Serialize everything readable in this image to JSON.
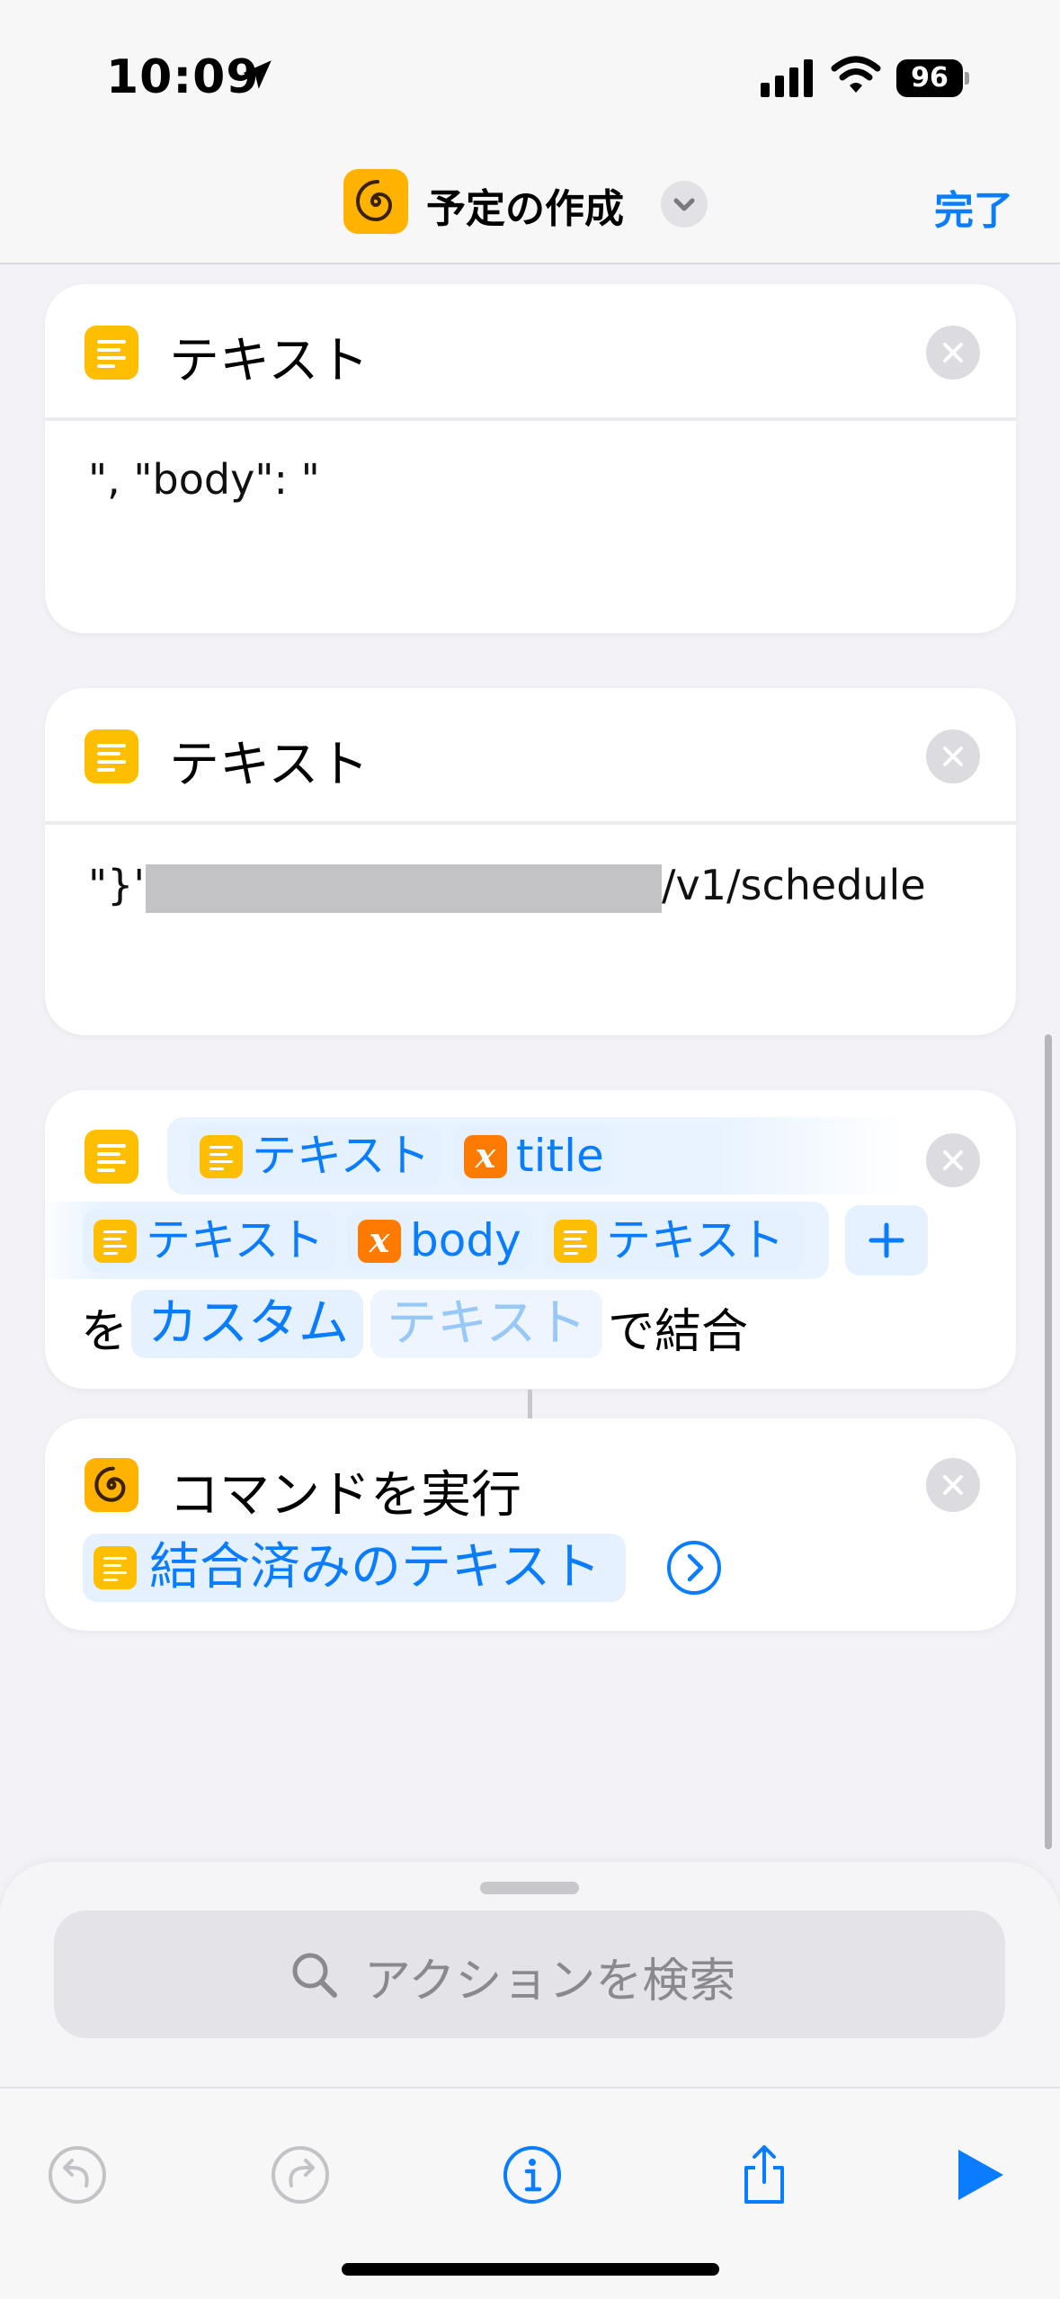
{
  "status_bar": {
    "time": "10:09",
    "battery": "96"
  },
  "nav": {
    "title": "予定の作成",
    "done": "完了"
  },
  "cards": {
    "text1": {
      "title": "テキスト",
      "content": "\", \"body\": \""
    },
    "text2": {
      "title": "テキスト",
      "content_prefix": "\"}'",
      "content_suffix": "/v1/schedule"
    },
    "combine": {
      "row1": {
        "tok1": "テキスト",
        "tok2": "title"
      },
      "row2": {
        "tok1": "テキスト",
        "tok2": "body",
        "tok3": "テキスト"
      },
      "row3": {
        "wo": "を",
        "custom": "カスタム",
        "placeholder": "テキスト",
        "suffix": "で結合"
      }
    },
    "run": {
      "title": "コマンドを実行",
      "token": "結合済みのテキスト"
    }
  },
  "search": {
    "placeholder": "アクションを検索"
  },
  "colors": {
    "accent": "#0a7cff",
    "text_icon": "#ffbf00",
    "variable_icon": "#ff7a00"
  },
  "icons": [
    "location-arrow-icon",
    "signal-icon",
    "wifi-icon",
    "battery-icon",
    "shortcut-spiral-icon",
    "chevron-down-icon",
    "text-icon",
    "variable-icon",
    "close-icon",
    "plus-icon",
    "chevron-right-circle-icon",
    "search-icon",
    "undo-icon",
    "redo-icon",
    "info-icon",
    "share-icon",
    "play-icon"
  ]
}
